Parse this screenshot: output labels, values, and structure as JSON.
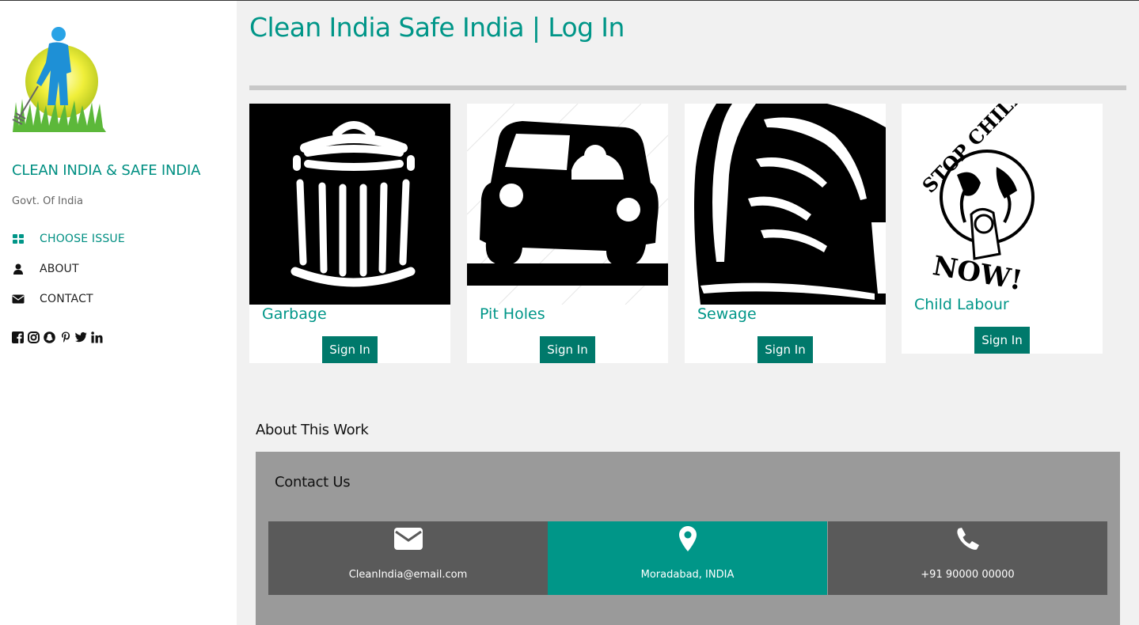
{
  "sidebar": {
    "brand": "CLEAN INDIA & SAFE INDIA",
    "subtitle": "Govt. Of India",
    "nav": [
      {
        "label": "CHOOSE ISSUE",
        "icon": "grid-icon"
      },
      {
        "label": "ABOUT",
        "icon": "user-icon"
      },
      {
        "label": "CONTACT",
        "icon": "envelope-icon"
      }
    ],
    "socials": [
      "facebook-icon",
      "instagram-icon",
      "snapchat-icon",
      "pinterest-icon",
      "twitter-icon",
      "linkedin-icon"
    ]
  },
  "main": {
    "title": "Clean India Safe India | Log In",
    "cards": [
      {
        "label": "Garbage",
        "button": "Sign In",
        "image": "trash-can-image"
      },
      {
        "label": "Pit Holes",
        "button": "Sign In",
        "image": "car-pothole-image"
      },
      {
        "label": "Sewage",
        "button": "Sign In",
        "image": "sewage-pipe-image"
      },
      {
        "label": "Child Labour",
        "button": "Sign In",
        "image": "stop-child-labor-image"
      }
    ],
    "about_heading": "About This Work",
    "contact": {
      "heading": "Contact Us",
      "items": [
        {
          "icon": "envelope-icon",
          "text": "CleanIndia@email.com"
        },
        {
          "icon": "map-marker-icon",
          "text": "Moradabad, INDIA"
        },
        {
          "icon": "phone-icon",
          "text": "+91 90000 00000"
        }
      ]
    }
  },
  "images": {
    "child_labour_poster_top": "STOP CHILD LABOR",
    "child_labour_poster_bottom": "NOW!"
  },
  "colors": {
    "accent": "#009688",
    "button": "#00796b",
    "panel": "#9a9a9a",
    "box": "#5a5a5a"
  }
}
